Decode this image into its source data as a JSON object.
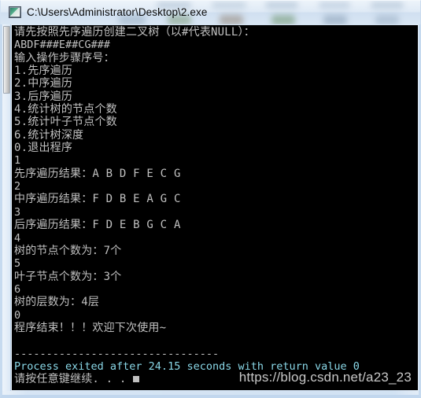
{
  "window": {
    "title": "C:\\Users\\Administrator\\Desktop\\2.exe",
    "icon": "console-window-icon"
  },
  "console": {
    "lines": [
      {
        "text": "请先按照先序遍历创建二叉树（以#代表NULL）：",
        "style": "cjk"
      },
      {
        "text": "ABDF###E##CG###",
        "style": "ascii"
      },
      {
        "text": "输入操作步骤序号：",
        "style": "cjk"
      },
      {
        "text": "1.先序遍历",
        "style": "cjk"
      },
      {
        "text": "2.中序遍历",
        "style": "cjk"
      },
      {
        "text": "3.后序遍历",
        "style": "cjk"
      },
      {
        "text": "4.统计树的节点个数",
        "style": "cjk"
      },
      {
        "text": "5.统计叶子节点个数",
        "style": "cjk"
      },
      {
        "text": "6.统计树深度",
        "style": "cjk"
      },
      {
        "text": "0.退出程序",
        "style": "cjk"
      },
      {
        "text": "1",
        "style": "ascii"
      },
      {
        "text": "先序遍历结果：A B D F E C G",
        "style": "cjk"
      },
      {
        "text": "2",
        "style": "ascii"
      },
      {
        "text": "中序遍历结果：F D B E A G C",
        "style": "cjk"
      },
      {
        "text": "3",
        "style": "ascii"
      },
      {
        "text": "后序遍历结果：F D E B G C A",
        "style": "cjk"
      },
      {
        "text": "4",
        "style": "ascii"
      },
      {
        "text": "树的节点个数为：7个",
        "style": "cjk"
      },
      {
        "text": "5",
        "style": "ascii"
      },
      {
        "text": "叶子节点个数为：3个",
        "style": "cjk"
      },
      {
        "text": "6",
        "style": "ascii"
      },
      {
        "text": "树的层数为：4层",
        "style": "cjk"
      },
      {
        "text": "0",
        "style": "ascii"
      },
      {
        "text": "程序结束！！！欢迎下次使用~",
        "style": "cjk"
      },
      {
        "text": "",
        "style": "blank"
      },
      {
        "text": "--------------------------------",
        "style": "ascii"
      },
      {
        "text": "Process exited after 24.15 seconds with return value 0",
        "style": "cyan"
      },
      {
        "text": "请按任意键继续. . . ",
        "style": "cjk-cursor"
      }
    ]
  },
  "watermark": {
    "text": "https://blog.csdn.net/a23_23"
  }
}
